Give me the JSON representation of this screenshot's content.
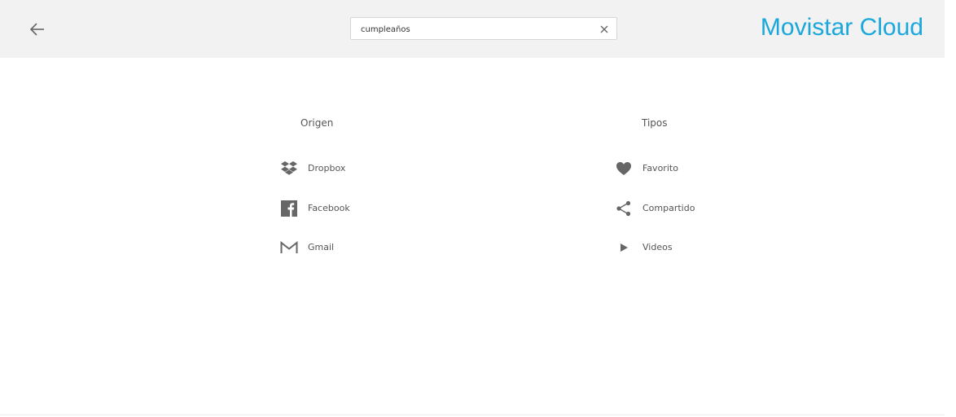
{
  "header": {
    "back_icon": "arrow-left-icon",
    "brand": "Movistar Cloud",
    "brand_color": "#1aa7dc",
    "background_color": "#f2f2f2"
  },
  "search": {
    "value": "cumpleaños",
    "clear_icon": "close-icon"
  },
  "filters": {
    "origin": {
      "title": "Origen",
      "items": [
        {
          "label": "Dropbox",
          "icon": "dropbox-icon"
        },
        {
          "label": "Facebook",
          "icon": "facebook-icon"
        },
        {
          "label": "Gmail",
          "icon": "gmail-icon"
        }
      ]
    },
    "types": {
      "title": "Tipos",
      "items": [
        {
          "label": "Favorito",
          "icon": "heart-icon"
        },
        {
          "label": "Compartido",
          "icon": "share-icon"
        },
        {
          "label": "Videos",
          "icon": "play-icon"
        }
      ]
    }
  }
}
